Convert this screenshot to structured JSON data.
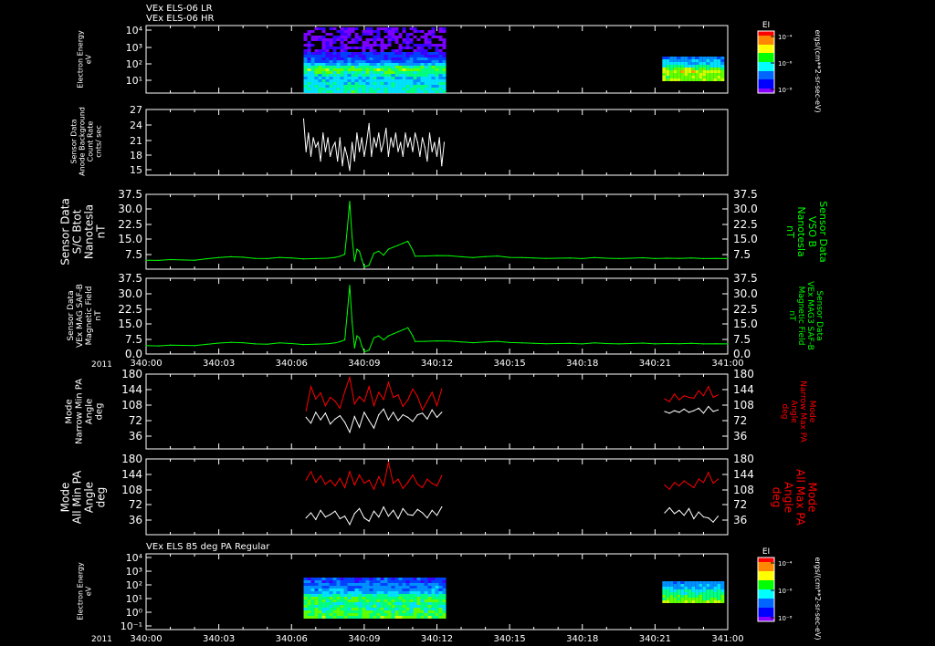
{
  "titles": {
    "top_line1": "VEx ELS-06 LR",
    "top_line2": "VEx ELS-06 HR",
    "bottom": "VEx ELS 85 deg PA Regular"
  },
  "time_axis": {
    "year": "2011",
    "ticks": [
      "340:00",
      "340:03",
      "340:06",
      "340:09",
      "340:12",
      "340:15",
      "340:18",
      "340:21",
      "341:00"
    ]
  },
  "colorbar": {
    "label": "EI",
    "units": "ergs/(cm**2-sr-sec-eV)",
    "ticks": [
      "10⁻⁴",
      "10⁻⁶",
      "10⁻⁸"
    ],
    "colors": [
      "#ff0000",
      "#ff8800",
      "#ffff00",
      "#00ff00",
      "#00ffff",
      "#0066ff",
      "#0000ff",
      "#8800ff"
    ]
  },
  "panels": {
    "p1": {
      "ylabel": [
        "Electron Energy",
        "eV"
      ],
      "yticks": [
        "10⁴",
        "10³",
        "10²",
        "10¹"
      ]
    },
    "p2": {
      "ylabel": [
        "Sensor Data",
        "Anode Background",
        "Count Rate",
        "cnts/ sec"
      ],
      "yticks": [
        "27",
        "24",
        "21",
        "18",
        "15"
      ]
    },
    "p3": {
      "ylabel": [
        "Sensor Data",
        "S/C Btot",
        "Nanotesla",
        "nT"
      ],
      "yticks": [
        "37.5",
        "30.0",
        "22.5",
        "15.0",
        "7.5"
      ],
      "rlabel": [
        "Sensor Data",
        "VSO B",
        "Nanotesla",
        "nT"
      ],
      "rticks": [
        "37.5",
        "30.0",
        "22.5",
        "15.0",
        "7.5"
      ]
    },
    "p4": {
      "ylabel": [
        "Sensor Data",
        "VEx MAG SAF-B",
        "Magnetic Field",
        "nT"
      ],
      "yticks": [
        "37.5",
        "30.0",
        "22.5",
        "15.0",
        "7.5",
        "0.0"
      ],
      "rlabel": [
        "Sensor Data",
        "VEx MAG3 SAF-B",
        "Magnetic Field",
        "nT"
      ],
      "rticks": [
        "37.5",
        "30.0",
        "22.5",
        "15.0",
        "7.5",
        "0.0"
      ]
    },
    "p5": {
      "ylabel": [
        "Mode",
        "Narrow Min PA",
        "Angle",
        "deg"
      ],
      "yticks": [
        "180",
        "144",
        "108",
        "72",
        "36"
      ],
      "rlabel": [
        "Mode",
        "Narrow Max PA",
        "Angle",
        "deg"
      ],
      "rticks": [
        "180",
        "144",
        "108",
        "72",
        "36"
      ]
    },
    "p6": {
      "ylabel": [
        "Mode",
        "All Min PA",
        "Angle",
        "deg"
      ],
      "yticks": [
        "180",
        "144",
        "108",
        "72",
        "36"
      ],
      "rlabel": [
        "Mode",
        "All Max PA",
        "Angle",
        "deg"
      ],
      "rticks": [
        "180",
        "144",
        "108",
        "72",
        "36"
      ]
    },
    "p7": {
      "ylabel": [
        "Electron Energy",
        "eV"
      ],
      "yticks": [
        "10⁴",
        "10³",
        "10²",
        "10¹",
        "10⁰",
        "10⁻¹"
      ]
    }
  },
  "chart_data": [
    {
      "type": "heatmap",
      "title": "VEx ELS-06 LR / VEx ELS-06 HR",
      "ylabel": "Electron Energy eV",
      "scale": "log",
      "ylim": [
        1,
        10000
      ],
      "data_intervals_hours": [
        [
          6.5,
          12.3
        ],
        [
          21.3,
          23.8
        ]
      ],
      "colorbar": "EI ergs/(cm**2-sr-sec-eV)"
    },
    {
      "type": "line",
      "ylabel": "Sensor Data Anode Background Count Rate cnts/sec",
      "ylim": [
        13,
        27
      ],
      "series": [
        {
          "color": "#ffffff",
          "x": [
            6.5,
            6.6,
            6.7,
            6.8,
            6.9,
            7.0,
            7.1,
            7.2,
            7.3,
            7.4,
            7.5,
            7.6,
            7.7,
            7.8,
            7.9,
            8.0,
            8.1,
            8.2,
            8.3,
            8.4,
            8.5,
            8.6,
            8.7,
            8.8,
            8.9,
            9.0,
            9.1,
            9.2,
            9.3,
            9.4,
            9.5,
            9.6,
            9.7,
            9.8,
            9.9,
            10.0,
            10.1,
            10.2,
            10.3,
            10.4,
            10.5,
            10.6,
            10.7,
            10.8,
            10.9,
            11.0,
            11.1,
            11.2,
            11.3,
            11.4,
            11.5,
            11.6,
            11.7,
            11.8,
            11.9,
            12.0,
            12.1,
            12.2,
            12.3
          ],
          "values": [
            25,
            18,
            22,
            17,
            21,
            19,
            20,
            16,
            22,
            18,
            21,
            17,
            19,
            20,
            16,
            21,
            15,
            19,
            17,
            14,
            20,
            16,
            22,
            18,
            21,
            17,
            20,
            24,
            17,
            21,
            19,
            22,
            18,
            20,
            23,
            17,
            21,
            19,
            22,
            18,
            20,
            17,
            22,
            19,
            21,
            18,
            22,
            20,
            17,
            21,
            19,
            16,
            22,
            18,
            20,
            17,
            21,
            15,
            20
          ]
        }
      ]
    },
    {
      "type": "line",
      "ylabel": "Sensor Data S/C Btot Nanotesla nT",
      "ylim": [
        0,
        37.5
      ],
      "series": [
        {
          "color": "#00ff00",
          "x": [
            0,
            0.5,
            1,
            1.5,
            2,
            2.5,
            3,
            3.5,
            4,
            4.5,
            5,
            5.5,
            6,
            6.5,
            7,
            7.5,
            7.8,
            8.0,
            8.2,
            8.3,
            8.4,
            8.5,
            8.6,
            8.7,
            8.8,
            8.9,
            9.0,
            9.2,
            9.4,
            9.6,
            9.8,
            10.0,
            10.2,
            10.4,
            10.6,
            10.8,
            11.0,
            11.1,
            11.5,
            12,
            12.5,
            13,
            13.5,
            14,
            14.5,
            15,
            15.5,
            16,
            16.5,
            17,
            17.5,
            18,
            18.5,
            19,
            19.5,
            20,
            20.5,
            21,
            21.5,
            22,
            22.5,
            23,
            23.5,
            24
          ],
          "values": [
            4.5,
            4.4,
            4.8,
            4.6,
            4.5,
            5.2,
            5.8,
            6.2,
            6.0,
            5.4,
            5.3,
            5.9,
            5.6,
            5.1,
            5.3,
            5.5,
            5.9,
            6.5,
            7.5,
            20,
            34,
            16,
            4,
            10,
            9,
            5,
            1,
            2,
            8,
            9,
            7,
            10,
            11,
            12,
            13,
            14,
            9.5,
            6.5,
            6.6,
            6.8,
            6.7,
            6.2,
            5.8,
            6.3,
            6.6,
            5.9,
            5.8,
            5.6,
            5.4,
            5.5,
            5.6,
            5.3,
            5.8,
            5.5,
            5.3,
            5.5,
            5.7,
            5.3,
            5.5,
            5.4,
            5.6,
            5.3,
            5.4,
            5.3
          ]
        }
      ]
    },
    {
      "type": "line",
      "ylabel": "Sensor Data VEx MAG SAF-B Magnetic Field nT",
      "ylim": [
        0,
        37.5
      ],
      "series": [
        {
          "color": "#00ff00",
          "x": [
            0,
            0.5,
            1,
            1.5,
            2,
            2.5,
            3,
            3.5,
            4,
            4.5,
            5,
            5.5,
            6,
            6.5,
            7,
            7.5,
            7.8,
            8.0,
            8.2,
            8.3,
            8.4,
            8.5,
            8.6,
            8.7,
            8.8,
            8.9,
            9.0,
            9.2,
            9.4,
            9.6,
            9.8,
            10.0,
            10.2,
            10.4,
            10.6,
            10.8,
            11.0,
            11.1,
            11.5,
            12,
            12.5,
            13,
            13.5,
            14,
            14.5,
            15,
            15.5,
            16,
            16.5,
            17,
            17.5,
            18,
            18.5,
            19,
            19.5,
            20,
            20.5,
            21,
            21.5,
            22,
            22.5,
            23,
            23.5,
            24
          ],
          "values": [
            4.2,
            4.0,
            4.4,
            4.3,
            4.2,
            4.8,
            5.4,
            5.8,
            5.6,
            5.0,
            4.9,
            5.5,
            5.2,
            4.7,
            4.9,
            5.1,
            5.5,
            6.1,
            7.0,
            20,
            34,
            16,
            3,
            9,
            8,
            4,
            1,
            2,
            8,
            9,
            7,
            9,
            10,
            11,
            12,
            13,
            9,
            6.2,
            6.3,
            6.5,
            6.4,
            6.0,
            5.6,
            6.0,
            6.3,
            5.7,
            5.5,
            5.3,
            5.1,
            5.2,
            5.3,
            5.0,
            5.5,
            5.2,
            5.0,
            5.2,
            5.4,
            5.0,
            5.2,
            5.1,
            5.3,
            5.0,
            5.1,
            5.0
          ]
        }
      ]
    },
    {
      "type": "line",
      "ylabel": "Mode Narrow Min PA Angle deg",
      "ylim": [
        0,
        180
      ],
      "series": [
        {
          "color": "#ff0000",
          "x": [
            6.6,
            6.8,
            7.0,
            7.2,
            7.4,
            7.6,
            7.8,
            8.0,
            8.2,
            8.4,
            8.6,
            8.8,
            9.0,
            9.2,
            9.4,
            9.6,
            9.8,
            10.0,
            10.2,
            10.4,
            10.6,
            10.8,
            11.0,
            11.2,
            11.4,
            11.6,
            11.8,
            12.0,
            12.2,
            21.4,
            21.6,
            21.8,
            22.0,
            22.2,
            22.4,
            22.6,
            22.8,
            23.0,
            23.2,
            23.4,
            23.6
          ],
          "values": [
            92,
            150,
            120,
            135,
            104,
            124,
            115,
            98,
            138,
            172,
            108,
            126,
            114,
            150,
            104,
            136,
            119,
            160,
            124,
            130,
            102,
            118,
            144,
            126,
            94,
            115,
            136,
            104,
            144,
            120,
            114,
            132,
            118,
            128,
            124,
            122,
            140,
            128,
            150,
            124,
            130
          ]
        },
        {
          "color": "#ffffff",
          "x": [
            6.6,
            6.8,
            7.0,
            7.2,
            7.4,
            7.6,
            7.8,
            8.0,
            8.2,
            8.4,
            8.6,
            8.8,
            9.0,
            9.2,
            9.4,
            9.6,
            9.8,
            10.0,
            10.2,
            10.4,
            10.6,
            10.8,
            11.0,
            11.2,
            11.4,
            11.6,
            11.8,
            12.0,
            12.2,
            21.4,
            21.6,
            21.8,
            22.0,
            22.2,
            22.4,
            22.6,
            22.8,
            23.0,
            23.2,
            23.4,
            23.6
          ],
          "values": [
            76,
            62,
            88,
            70,
            86,
            60,
            72,
            80,
            64,
            40,
            78,
            52,
            88,
            68,
            50,
            82,
            96,
            70,
            88,
            68,
            82,
            76,
            66,
            82,
            86,
            72,
            94,
            76,
            88,
            90,
            86,
            92,
            88,
            96,
            88,
            92,
            98,
            86,
            102,
            90,
            94
          ]
        }
      ]
    },
    {
      "type": "line",
      "ylabel": "Mode All Min PA Angle deg",
      "ylim": [
        0,
        180
      ],
      "series": [
        {
          "color": "#ff0000",
          "x": [
            6.6,
            6.8,
            7.0,
            7.2,
            7.4,
            7.6,
            7.8,
            8.0,
            8.2,
            8.4,
            8.6,
            8.8,
            9.0,
            9.2,
            9.4,
            9.6,
            9.8,
            10.0,
            10.2,
            10.4,
            10.6,
            10.8,
            11.0,
            11.2,
            11.4,
            11.6,
            11.8,
            12.0,
            12.2,
            21.4,
            21.6,
            21.8,
            22.0,
            22.2,
            22.4,
            22.6,
            22.8,
            23.0,
            23.2,
            23.4,
            23.6
          ],
          "values": [
            130,
            150,
            124,
            140,
            120,
            130,
            116,
            134,
            112,
            150,
            118,
            142,
            122,
            130,
            108,
            138,
            116,
            172,
            122,
            132,
            110,
            124,
            142,
            120,
            112,
            132,
            122,
            116,
            140,
            118,
            108,
            124,
            116,
            128,
            120,
            112,
            132,
            124,
            148,
            122,
            132
          ]
        },
        {
          "color": "#ffffff",
          "x": [
            6.6,
            6.8,
            7.0,
            7.2,
            7.4,
            7.6,
            7.8,
            8.0,
            8.2,
            8.4,
            8.6,
            8.8,
            9.0,
            9.2,
            9.4,
            9.6,
            9.8,
            10.0,
            10.2,
            10.4,
            10.6,
            10.8,
            11.0,
            11.2,
            11.4,
            11.6,
            11.8,
            12.0,
            12.2,
            21.4,
            21.6,
            21.8,
            22.0,
            22.2,
            22.4,
            22.6,
            22.8,
            23.0,
            23.2,
            23.4,
            23.6
          ],
          "values": [
            40,
            52,
            36,
            58,
            42,
            48,
            56,
            38,
            44,
            24,
            50,
            62,
            40,
            32,
            56,
            42,
            66,
            44,
            58,
            38,
            62,
            48,
            46,
            60,
            52,
            40,
            58,
            46,
            66,
            52,
            64,
            50,
            58,
            46,
            62,
            38,
            54,
            42,
            40,
            30,
            44
          ]
        }
      ]
    },
    {
      "type": "heatmap",
      "title": "VEx ELS 85 deg PA Regular",
      "ylabel": "Electron Energy eV",
      "scale": "log",
      "ylim": [
        0.1,
        10000
      ],
      "data_intervals_hours": [
        [
          6.5,
          12.3
        ],
        [
          21.3,
          23.8
        ]
      ],
      "colorbar": "EI ergs/(cm**2-sr-sec-eV)"
    }
  ]
}
